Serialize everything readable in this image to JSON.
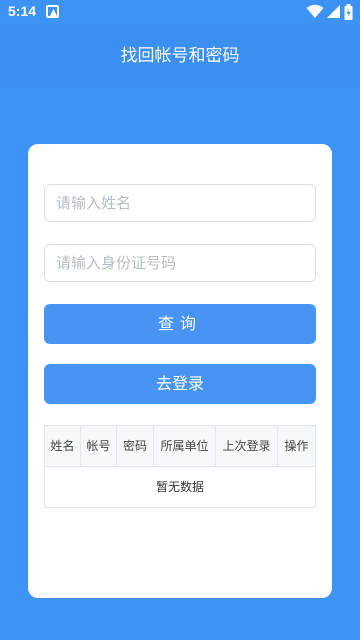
{
  "status_bar": {
    "time": "5:14",
    "icons": [
      "notification-icon",
      "wifi-icon",
      "signal-icon",
      "battery-icon"
    ]
  },
  "app_bar": {
    "title": "找回帐号和密码"
  },
  "form": {
    "name_placeholder": "请输入姓名",
    "name_value": "",
    "id_placeholder": "请输入身份证号码",
    "id_value": "",
    "query_label": "查询",
    "login_label": "去登录"
  },
  "table": {
    "columns": [
      "姓名",
      "帐号",
      "密码",
      "所属单位",
      "上次登录",
      "操作"
    ],
    "rows": [],
    "empty_text": "暂无数据"
  },
  "colors": {
    "background": "#3d93f3",
    "button": "#4794f2",
    "card": "#ffffff"
  }
}
